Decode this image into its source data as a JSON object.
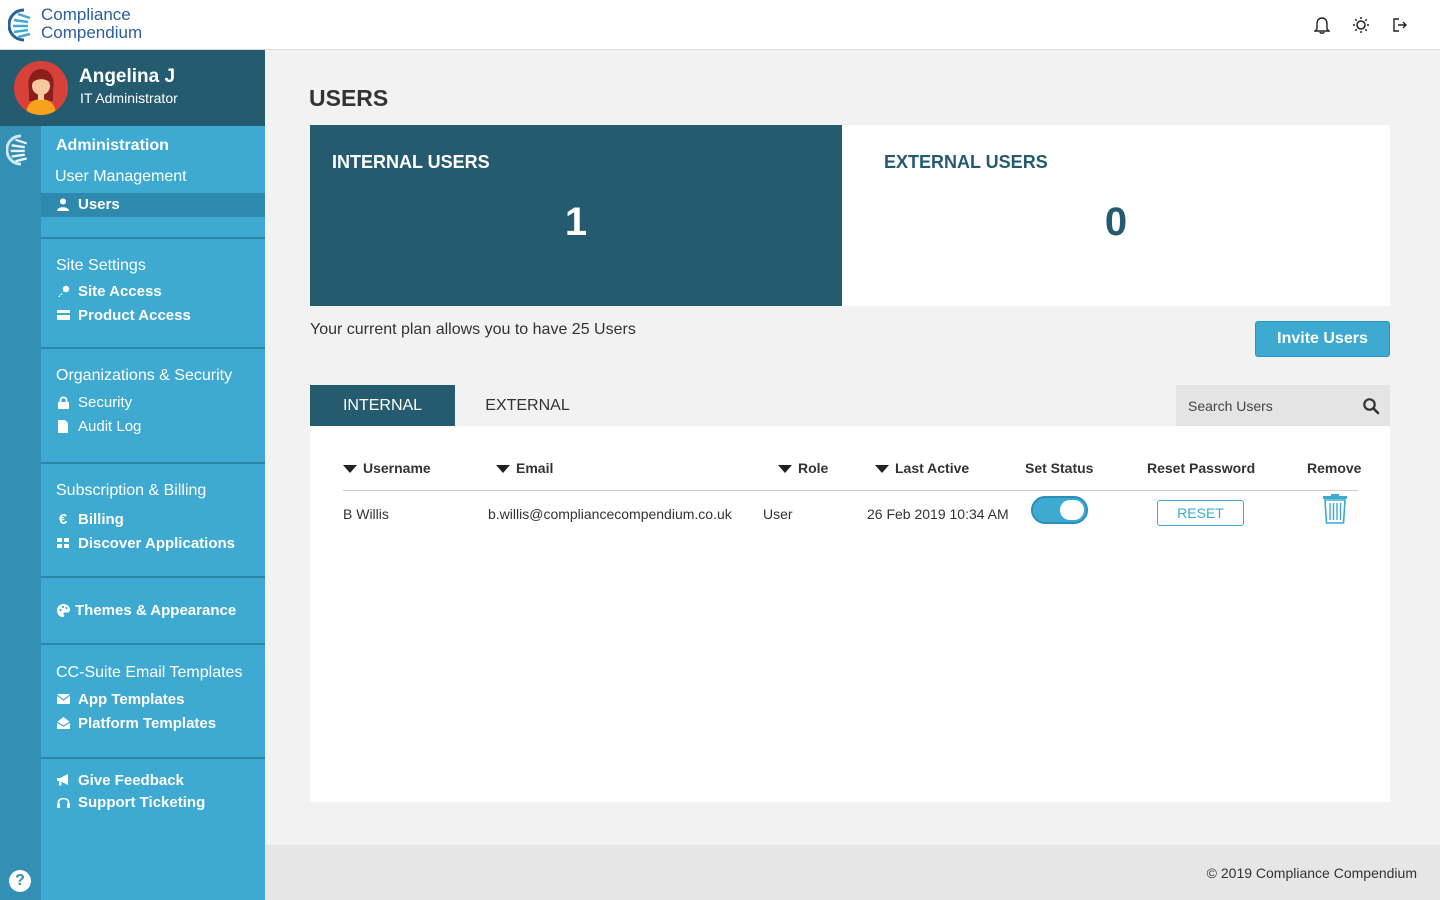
{
  "app": {
    "brand_line1": "Compliance",
    "brand_line2": "Compendium"
  },
  "header": {
    "icons": [
      "bell-icon",
      "sun-icon",
      "logout-icon"
    ]
  },
  "profile": {
    "name": "Angelina J",
    "role": "IT Administrator"
  },
  "sidebar": {
    "administration": "Administration",
    "user_management": "User Management",
    "users": "Users",
    "site_settings": "Site Settings",
    "site_access": "Site Access",
    "product_access": "Product Access",
    "org_security": "Organizations & Security",
    "security": "Security",
    "audit_log": "Audit Log",
    "subscription_billing": "Subscription & Billing",
    "billing": "Billing",
    "discover_applications": "Discover Applications",
    "themes_appearance": "Themes & Appearance",
    "email_templates": "CC-Suite Email Templates",
    "app_templates": "App Templates",
    "platform_templates": "Platform Templates",
    "give_feedback": "Give Feedback",
    "support_ticketing": "Support Ticketing",
    "help": "?"
  },
  "main": {
    "page_title": "USERS",
    "internal_card": {
      "title": "INTERNAL USERS",
      "count": "1"
    },
    "external_card": {
      "title": "EXTERNAL USERS",
      "count": "0"
    },
    "plan_text": "Your current plan allows you to have 25 Users",
    "invite_label": "Invite Users",
    "tabs": {
      "internal": "INTERNAL",
      "external": "EXTERNAL"
    },
    "search_placeholder": "Search Users",
    "table": {
      "headers": {
        "username": "Username",
        "email": "Email",
        "role": "Role",
        "last_active": "Last Active",
        "set_status": "Set Status",
        "reset_password": "Reset Password",
        "remove": "Remove"
      },
      "rows": [
        {
          "username": "B Willis",
          "email": "b.willis@compliancecompendium.co.uk",
          "role": "User",
          "last_active": "26 Feb 2019 10:34 AM",
          "status_on": true,
          "reset_label": "RESET"
        }
      ]
    }
  },
  "footer": {
    "copyright": "© 2019 Compliance Compendium"
  },
  "colors": {
    "dark_teal": "#255b6e",
    "sidebar_blue": "#3eaad2",
    "rail_blue": "#348fb4",
    "brand_blue": "#2b5f9e"
  }
}
